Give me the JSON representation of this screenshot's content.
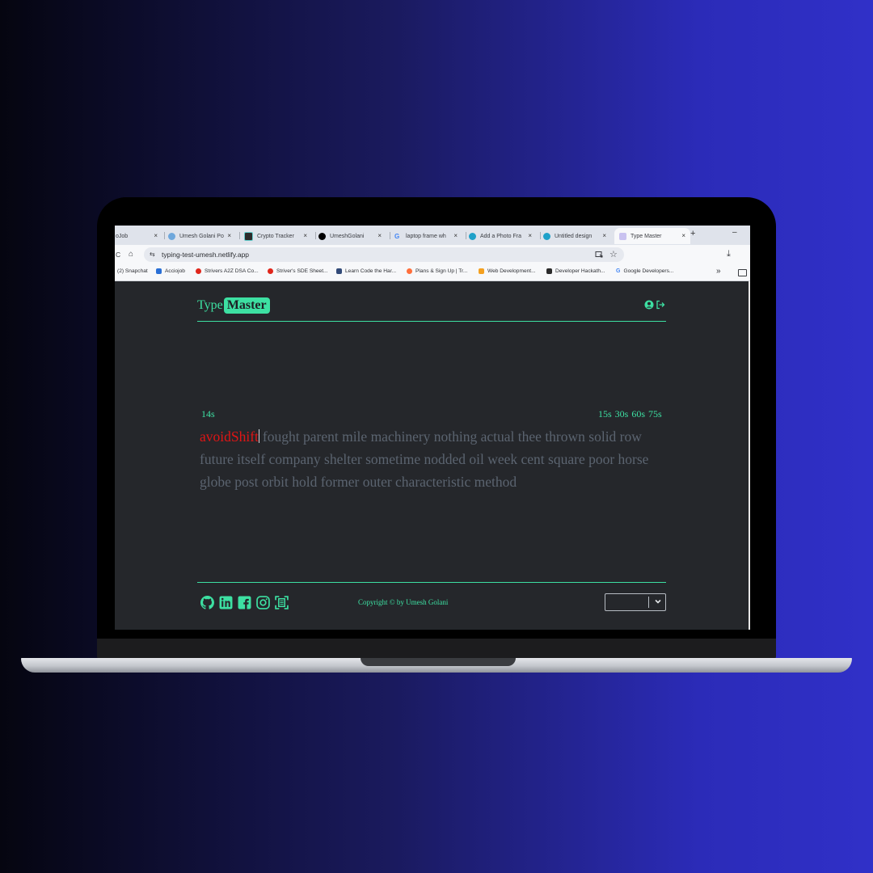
{
  "browser": {
    "tabs": [
      {
        "label": "oJob",
        "favicon_color": "#ffffff"
      },
      {
        "label": "Umesh Golani Po",
        "favicon_color": "#6fa8dc"
      },
      {
        "label": "Crypto Tracker",
        "favicon_color": "#2b2b2b"
      },
      {
        "label": "UmeshGolani",
        "favicon_color": "#000000"
      },
      {
        "label": "laptop frame wh",
        "favicon_color": "#4285f4"
      },
      {
        "label": "Add a Photo Fra",
        "favicon_color": "#1fa1c9"
      },
      {
        "label": "Untitled design",
        "favicon_color": "#1fa1c9"
      },
      {
        "label": "Type Master",
        "favicon_color": "#7b6fd6"
      }
    ],
    "new_tab": "+",
    "minimize": "–",
    "close": "×",
    "url": "typing-test-umesh.netlify.app",
    "reload": "C",
    "home": "⌂",
    "site_settings": "⇆",
    "star": "☆",
    "download": "⤓",
    "bookmarks": [
      {
        "label": "(2) Snapchat",
        "color": "#ffffff"
      },
      {
        "label": "Acciojob",
        "color": "#2a6fd6"
      },
      {
        "label": "Strivers A2Z DSA Co...",
        "color": "#e0261b"
      },
      {
        "label": "Striver's SDE Sheet...",
        "color": "#e0261b"
      },
      {
        "label": "Learn Code the Har...",
        "color": "#324a78"
      },
      {
        "label": "Plans & Sign Up | Tr...",
        "color": "#ff6f3c"
      },
      {
        "label": "Web Development...",
        "color": "#f4a020"
      },
      {
        "label": "Developer Hackath...",
        "color": "#2b2b2b"
      },
      {
        "label": "Google Developers...",
        "color": "#4285f4"
      }
    ],
    "more_bookmarks": "»"
  },
  "app": {
    "logo_part1": "Type",
    "logo_part2": "Master",
    "timer": "14s",
    "time_modes": [
      "15s",
      "30s",
      "60s",
      "75s"
    ],
    "current_word": "avoidShift",
    "remaining_words": "fought parent mile machinery nothing actual thee thrown solid row future itself company shelter sometime nodded oil week cent square poor horse globe post orbit hold former outer characteristic method",
    "copyright": "Copyright © by Umesh Golani",
    "theme_selected": "",
    "colors": {
      "accent": "#3de0a2",
      "error": "#e01515",
      "background": "#25272b",
      "untyped": "#5b6470"
    },
    "social_icons": [
      "github-icon",
      "linkedin-icon",
      "facebook-icon",
      "instagram-icon",
      "scan-icon"
    ]
  }
}
